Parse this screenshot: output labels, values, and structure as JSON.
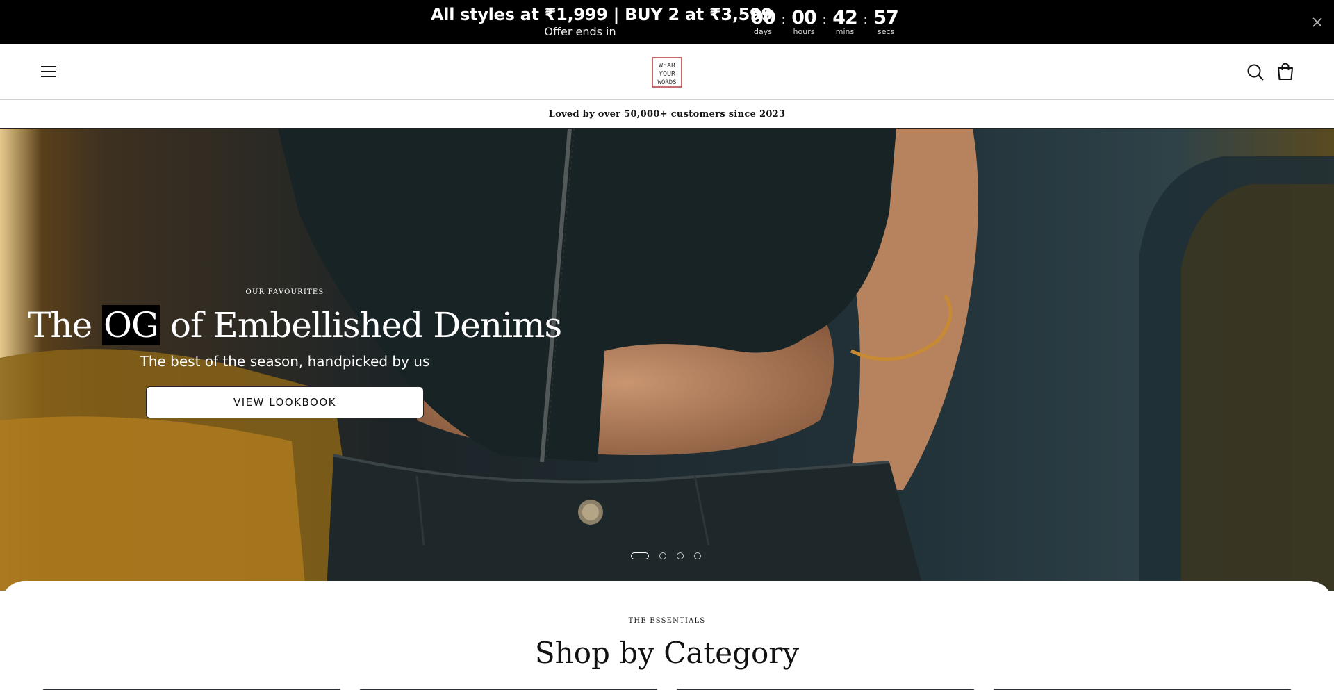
{
  "promo": {
    "headline": "All styles at ₹1,999 | BUY 2 at ₹3,599",
    "subtext": "Offer ends in",
    "countdown": [
      {
        "value": "00",
        "label": "days"
      },
      {
        "value": "00",
        "label": "hours"
      },
      {
        "value": "42",
        "label": "mins"
      },
      {
        "value": "57",
        "label": "secs"
      }
    ],
    "separator": ":",
    "close_icon": "close-icon"
  },
  "header": {
    "menu_icon": "hamburger-menu-icon",
    "logo_lines": [
      "WEAR",
      "YOUR",
      "WORDS"
    ],
    "search_icon": "search-icon",
    "cart_icon": "shopping-bag-icon"
  },
  "trust_bar": {
    "text": "Loved by over 50,000+ customers since 2023"
  },
  "hero": {
    "kicker": "OUR FAVOURITES",
    "title_before": "The ",
    "title_highlight": "OG",
    "title_after": " of Embellished Denims",
    "subtitle": "The best of the season, handpicked by us",
    "cta_label": "VIEW LOOKBOOK",
    "slides_total": 4,
    "active_slide": 1
  },
  "category": {
    "kicker": "THE ESSENTIALS",
    "title": "Shop by Category"
  },
  "colors": {
    "promo_bg": "#000000",
    "logo_accent": "#b23a3a",
    "hero_bg": "#1a2226"
  }
}
